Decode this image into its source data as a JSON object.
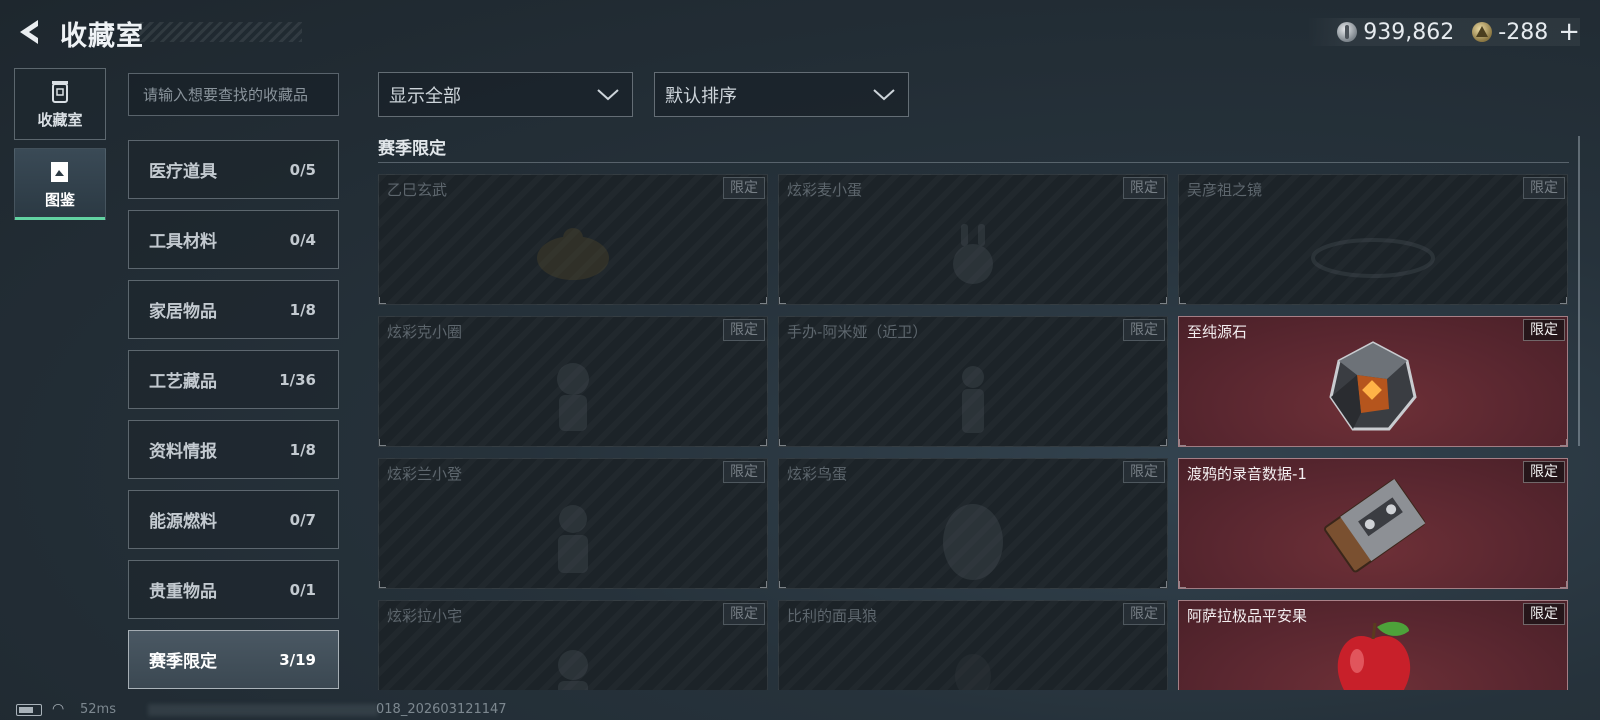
{
  "header": {
    "title": "收藏室",
    "currencies": [
      {
        "icon": "silver-coin-icon",
        "value": "939,862"
      },
      {
        "icon": "gold-triangle-icon",
        "value": "-288"
      }
    ],
    "add_label": "+"
  },
  "nav": [
    {
      "label": "收藏室",
      "icon": "trash-bin-icon",
      "active": false
    },
    {
      "label": "图鉴",
      "icon": "book-icon",
      "active": true
    }
  ],
  "search": {
    "placeholder": "请输入想要查找的收藏品"
  },
  "categories": [
    {
      "name": "医疗道具",
      "count": "0/5"
    },
    {
      "name": "工具材料",
      "count": "0/4"
    },
    {
      "name": "家居物品",
      "count": "1/8"
    },
    {
      "name": "工艺藏品",
      "count": "1/36"
    },
    {
      "name": "资料情报",
      "count": "1/8"
    },
    {
      "name": "能源燃料",
      "count": "0/7"
    },
    {
      "name": "贵重物品",
      "count": "0/1"
    },
    {
      "name": "赛季限定",
      "count": "3/19",
      "active": true
    }
  ],
  "filters": {
    "display": "显示全部",
    "sort": "默认排序"
  },
  "section": {
    "title": "赛季限定"
  },
  "items": [
    {
      "name": "乙巳玄武",
      "badge": "限定",
      "owned": false
    },
    {
      "name": "炫彩麦小蛋",
      "badge": "限定",
      "owned": false
    },
    {
      "name": "吴彦祖之镜",
      "badge": "限定",
      "owned": false
    },
    {
      "name": "炫彩克小圈",
      "badge": "限定",
      "owned": false
    },
    {
      "name": "手办-阿米娅（近卫）",
      "badge": "限定",
      "owned": false
    },
    {
      "name": "至纯源石",
      "badge": "限定",
      "owned": true
    },
    {
      "name": "炫彩兰小登",
      "badge": "限定",
      "owned": false
    },
    {
      "name": "炫彩鸟蛋",
      "badge": "限定",
      "owned": false
    },
    {
      "name": "渡鸦的录音数据-1",
      "badge": "限定",
      "owned": true
    },
    {
      "name": "炫彩拉小宅",
      "badge": "限定",
      "owned": false
    },
    {
      "name": "比利的面具狼",
      "badge": "限定",
      "owned": false
    },
    {
      "name": "阿萨拉极品平安果",
      "badge": "限定",
      "owned": true
    }
  ],
  "status": {
    "ping": "52ms",
    "build": "018_202603121147"
  }
}
